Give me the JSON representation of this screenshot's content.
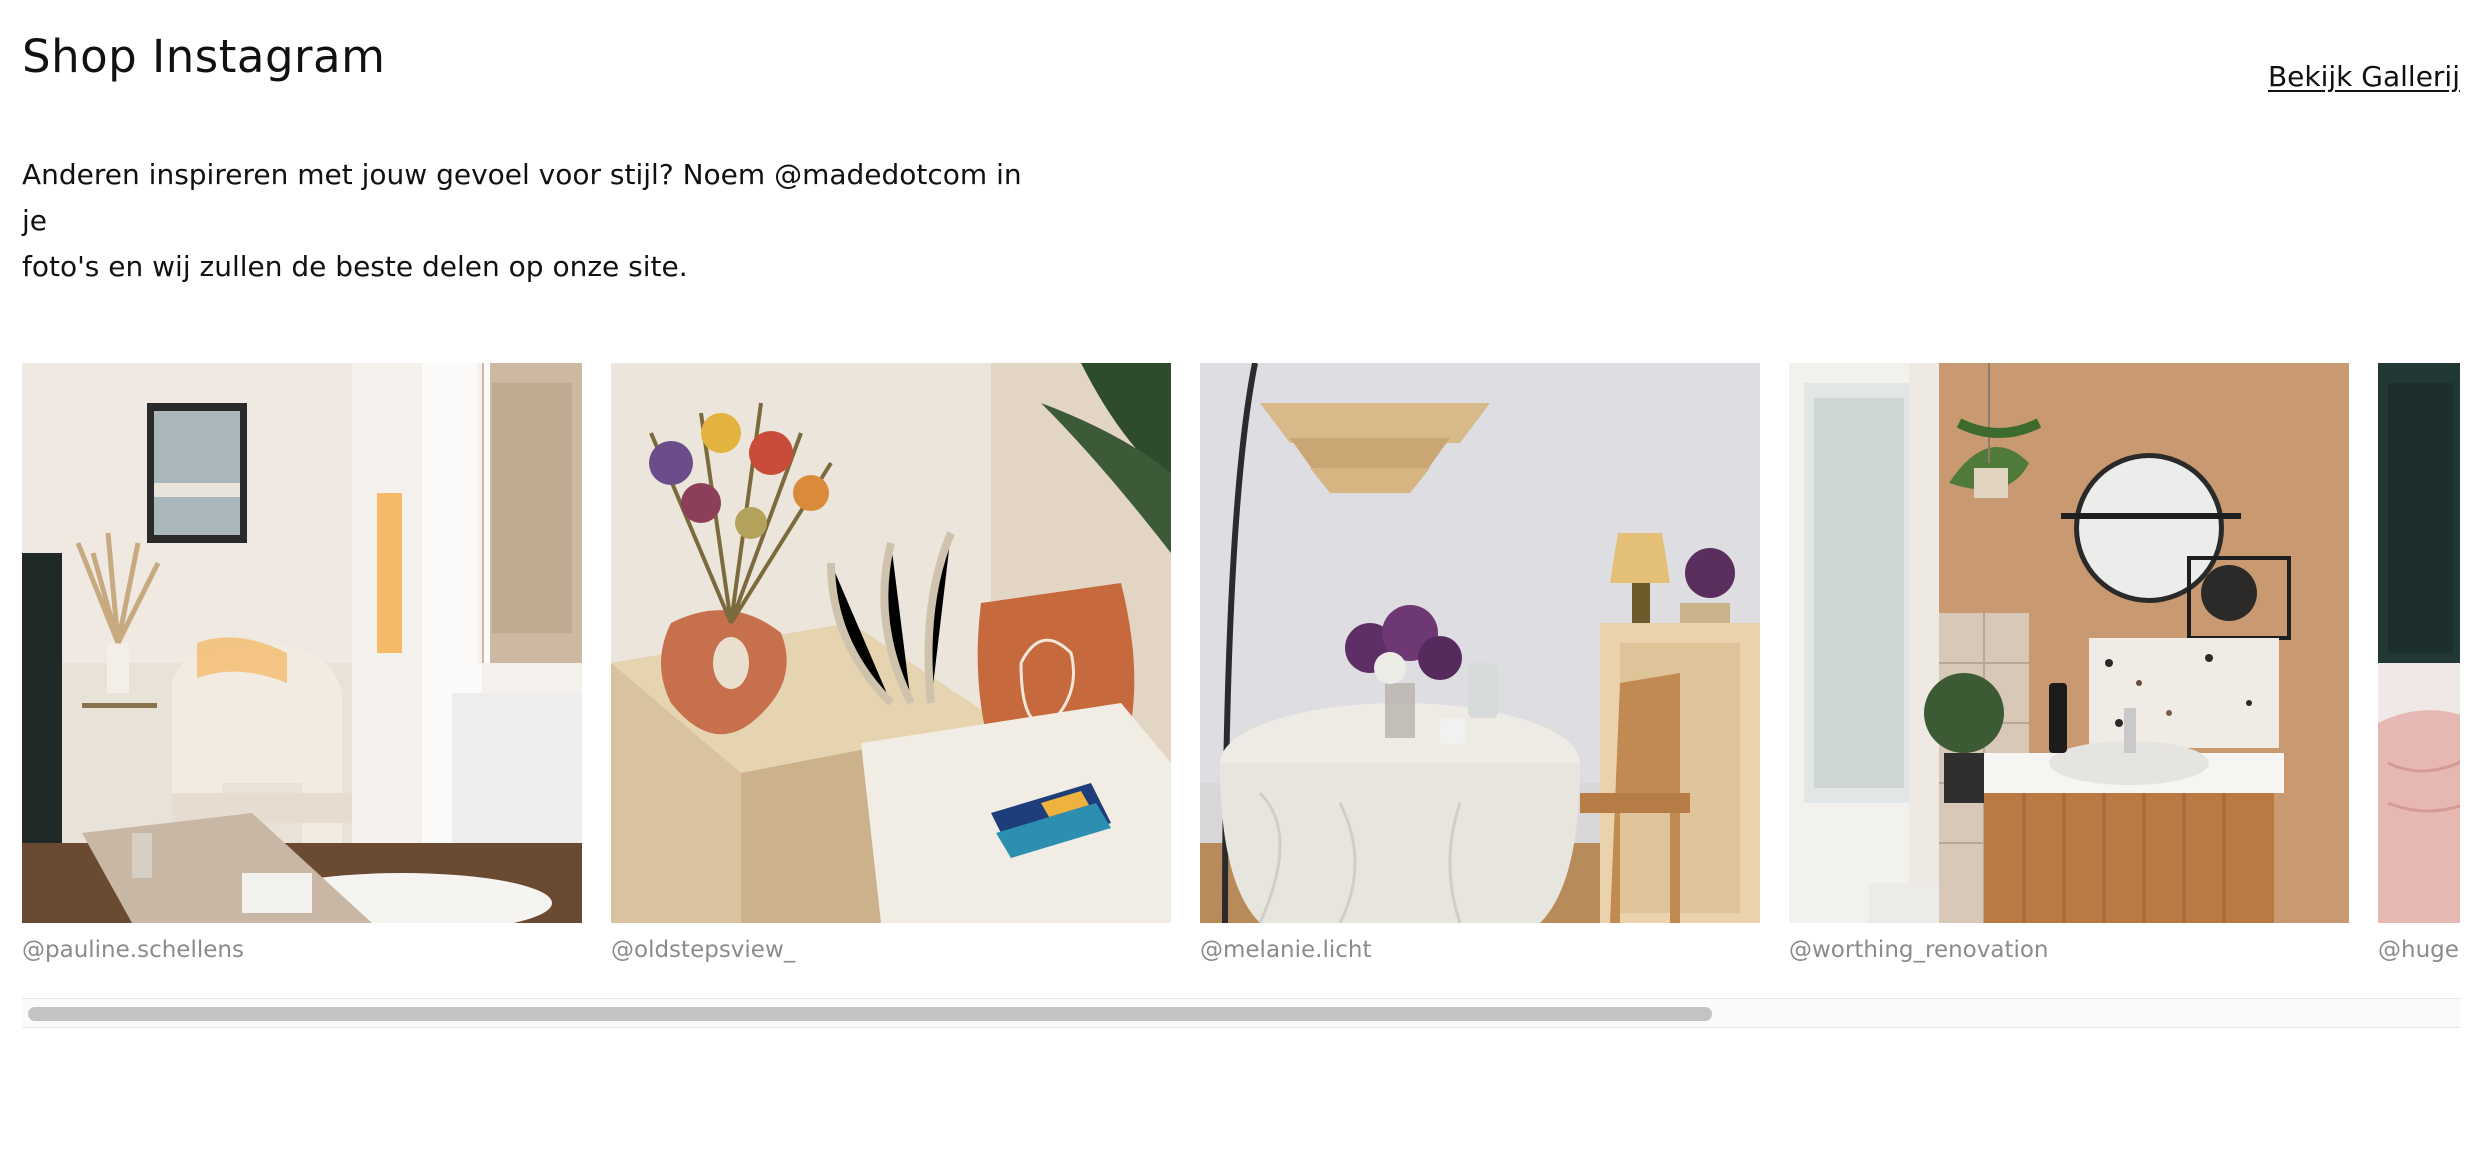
{
  "header": {
    "title": "Shop Instagram",
    "gallery_link": "Bekijk Gallerij"
  },
  "intro": {
    "line1": "Anderen inspireren met jouw gevoel voor stijl? Noem @madedotcom in je",
    "line2": "foto's en wij zullen de beste delen op onze site."
  },
  "posts": [
    {
      "handle": "@pauline.schellens",
      "photo": "living-room-armchair-photo"
    },
    {
      "handle": "@oldstepsview_",
      "photo": "dried-flowers-vase-photo"
    },
    {
      "handle": "@melanie.licht",
      "photo": "dining-table-lilacs-photo"
    },
    {
      "handle": "@worthing_renovation",
      "photo": "bathroom-vanity-photo"
    },
    {
      "handle": "@huges",
      "photo": "bedroom-photo"
    }
  ],
  "scrollbar": {
    "position_fraction": 0.0,
    "visible_fraction": 0.69
  }
}
